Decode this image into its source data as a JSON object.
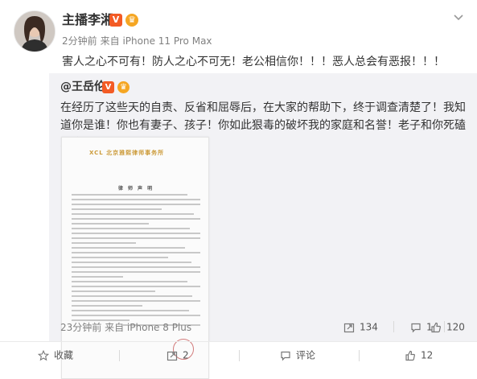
{
  "post": {
    "author": "主播李湘",
    "time": "2分钟前",
    "source": "来自 iPhone 11 Pro Max",
    "text": "害人之心不可有！防人之心不可无！老公相信你！！！恶人总会有恶报！！！",
    "menu_icon": "chevron-down-icon"
  },
  "repost": {
    "author": "@王岳伦",
    "text": "在经历了这些天的自责、反省和屈辱后，在大家的帮助下，终于调查清楚了！我知道你是谁！你也有妻子、孩子！你如此狠毒的破坏我的家庭和名誉！老子和你死磕到底！！！",
    "document": {
      "logo_text": "XCL 北京雅熙律师事务所",
      "title": "律 师 声 明"
    },
    "time": "23分钟前",
    "source": "来自 iPhone 8 Plus",
    "stats": {
      "reposts": "134",
      "comments": "1",
      "likes": "120"
    }
  },
  "actions": {
    "favorite": "收藏",
    "repost": "2",
    "comment": "评论",
    "like": "12"
  },
  "colors": {
    "badge_v": "#f35b25",
    "badge_crown": "#f5a623",
    "meta_gray": "#808080",
    "repost_bg": "#f2f2f5"
  }
}
